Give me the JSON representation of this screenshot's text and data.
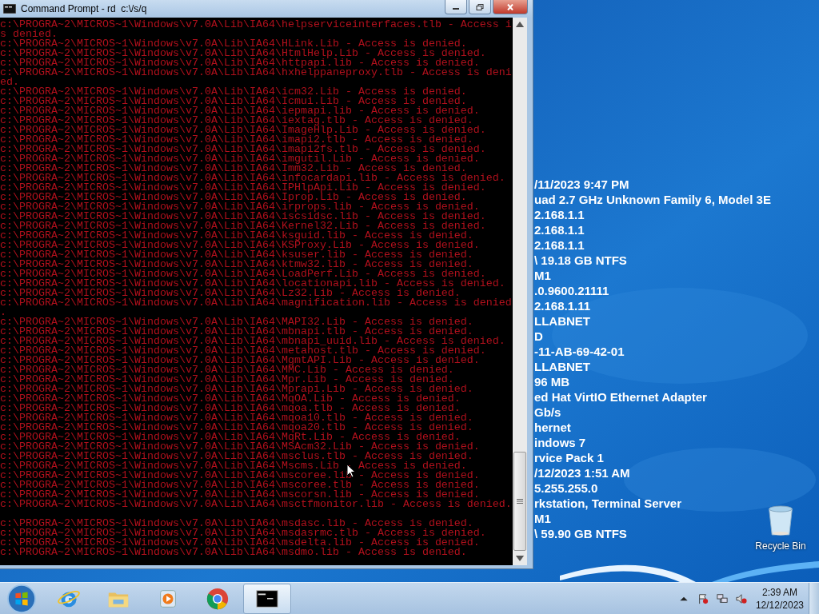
{
  "window": {
    "title": "Command Prompt - rd  c:\\/s/q",
    "console_blocks": [
      [
        "c:\\PROGRA~2\\MICROS~1\\Windows\\v7.0A\\Lib\\IA64\\helpserviceinterfaces.tlb - Access i",
        "s denied.",
        "c:\\PROGRA~2\\MICROS~1\\Windows\\v7.0A\\Lib\\IA64\\HLink.Lib - Access is denied.",
        "c:\\PROGRA~2\\MICROS~1\\Windows\\v7.0A\\Lib\\IA64\\HtmlHelp.Lib - Access is denied.",
        "c:\\PROGRA~2\\MICROS~1\\Windows\\v7.0A\\Lib\\IA64\\httpapi.lib - Access is denied.",
        "c:\\PROGRA~2\\MICROS~1\\Windows\\v7.0A\\Lib\\IA64\\hxhelppaneproxy.tlb - Access is deni",
        "ed.",
        "c:\\PROGRA~2\\MICROS~1\\Windows\\v7.0A\\Lib\\IA64\\icm32.Lib - Access is denied.",
        "c:\\PROGRA~2\\MICROS~1\\Windows\\v7.0A\\Lib\\IA64\\Icmui.Lib - Access is denied.",
        "c:\\PROGRA~2\\MICROS~1\\Windows\\v7.0A\\Lib\\IA64\\iepmapi.lib - Access is denied.",
        "c:\\PROGRA~2\\MICROS~1\\Windows\\v7.0A\\Lib\\IA64\\iextag.tlb - Access is denied.",
        "c:\\PROGRA~2\\MICROS~1\\Windows\\v7.0A\\Lib\\IA64\\ImageHlp.Lib - Access is denied.",
        "c:\\PROGRA~2\\MICROS~1\\Windows\\v7.0A\\Lib\\IA64\\imapi2.tlb - Access is denied.",
        "c:\\PROGRA~2\\MICROS~1\\Windows\\v7.0A\\Lib\\IA64\\imapi2fs.tlb - Access is denied.",
        "c:\\PROGRA~2\\MICROS~1\\Windows\\v7.0A\\Lib\\IA64\\imgutil.Lib - Access is denied.",
        "c:\\PROGRA~2\\MICROS~1\\Windows\\v7.0A\\Lib\\IA64\\Imm32.Lib - Access is denied.",
        "c:\\PROGRA~2\\MICROS~1\\Windows\\v7.0A\\Lib\\IA64\\infocardapi.lib - Access is denied.",
        "c:\\PROGRA~2\\MICROS~1\\Windows\\v7.0A\\Lib\\IA64\\IPHlpApi.Lib - Access is denied.",
        "c:\\PROGRA~2\\MICROS~1\\Windows\\v7.0A\\Lib\\IA64\\Iprop.Lib - Access is denied.",
        "c:\\PROGRA~2\\MICROS~1\\Windows\\v7.0A\\Lib\\IA64\\irprops.lib - Access is denied.",
        "c:\\PROGRA~2\\MICROS~1\\Windows\\v7.0A\\Lib\\IA64\\iscsidsc.lib - Access is denied.",
        "c:\\PROGRA~2\\MICROS~1\\Windows\\v7.0A\\Lib\\IA64\\Kernel32.Lib - Access is denied.",
        "c:\\PROGRA~2\\MICROS~1\\Windows\\v7.0A\\Lib\\IA64\\ksguid.lib - Access is denied.",
        "c:\\PROGRA~2\\MICROS~1\\Windows\\v7.0A\\Lib\\IA64\\KSProxy.Lib - Access is denied.",
        "c:\\PROGRA~2\\MICROS~1\\Windows\\v7.0A\\Lib\\IA64\\ksuser.lib - Access is denied.",
        "c:\\PROGRA~2\\MICROS~1\\Windows\\v7.0A\\Lib\\IA64\\ktmw32.lib - Access is denied.",
        "c:\\PROGRA~2\\MICROS~1\\Windows\\v7.0A\\Lib\\IA64\\LoadPerf.Lib - Access is denied.",
        "c:\\PROGRA~2\\MICROS~1\\Windows\\v7.0A\\Lib\\IA64\\locationapi.lib - Access is denied.",
        "c:\\PROGRA~2\\MICROS~1\\Windows\\v7.0A\\Lib\\IA64\\Lz32.Lib - Access is denied.",
        "c:\\PROGRA~2\\MICROS~1\\Windows\\v7.0A\\Lib\\IA64\\magnification.lib - Access is denied",
        ".",
        "c:\\PROGRA~2\\MICROS~1\\Windows\\v7.0A\\Lib\\IA64\\MAPI32.Lib - Access is denied.",
        "c:\\PROGRA~2\\MICROS~1\\Windows\\v7.0A\\Lib\\IA64\\mbnapi.tlb - Access is denied.",
        "c:\\PROGRA~2\\MICROS~1\\Windows\\v7.0A\\Lib\\IA64\\mbnapi_uuid.lib - Access is denied.",
        "c:\\PROGRA~2\\MICROS~1\\Windows\\v7.0A\\Lib\\IA64\\metahost.tlb - Access is denied.",
        "c:\\PROGRA~2\\MICROS~1\\Windows\\v7.0A\\Lib\\IA64\\MgmtAPI.Lib - Access is denied.",
        "c:\\PROGRA~2\\MICROS~1\\Windows\\v7.0A\\Lib\\IA64\\MMC.Lib - Access is denied.",
        "c:\\PROGRA~2\\MICROS~1\\Windows\\v7.0A\\Lib\\IA64\\Mpr.Lib - Access is denied.",
        "c:\\PROGRA~2\\MICROS~1\\Windows\\v7.0A\\Lib\\IA64\\Mprapi.Lib - Access is denied.",
        "c:\\PROGRA~2\\MICROS~1\\Windows\\v7.0A\\Lib\\IA64\\MqOA.Lib - Access is denied.",
        "c:\\PROGRA~2\\MICROS~1\\Windows\\v7.0A\\Lib\\IA64\\mqoa.tlb - Access is denied.",
        "c:\\PROGRA~2\\MICROS~1\\Windows\\v7.0A\\Lib\\IA64\\mqoa10.tlb - Access is denied.",
        "c:\\PROGRA~2\\MICROS~1\\Windows\\v7.0A\\Lib\\IA64\\mqoa20.tlb - Access is denied.",
        "c:\\PROGRA~2\\MICROS~1\\Windows\\v7.0A\\Lib\\IA64\\MqRt.Lib - Access is denied.",
        "c:\\PROGRA~2\\MICROS~1\\Windows\\v7.0A\\Lib\\IA64\\MSAcm32.Lib - Access is denied.",
        "c:\\PROGRA~2\\MICROS~1\\Windows\\v7.0A\\Lib\\IA64\\msclus.tlb - Access is denied.",
        "c:\\PROGRA~2\\MICROS~1\\Windows\\v7.0A\\Lib\\IA64\\Mscms.Lib - Access is denied.",
        "c:\\PROGRA~2\\MICROS~1\\Windows\\v7.0A\\Lib\\IA64\\mscoree.lib - Access is denied.",
        "c:\\PROGRA~2\\MICROS~1\\Windows\\v7.0A\\Lib\\IA64\\mscoree.tlb - Access is denied.",
        "c:\\PROGRA~2\\MICROS~1\\Windows\\v7.0A\\Lib\\IA64\\mscorsn.lib - Access is denied.",
        "c:\\PROGRA~2\\MICROS~1\\Windows\\v7.0A\\Lib\\IA64\\msctfmonitor.lib - Access is denied."
      ],
      [
        "c:\\PROGRA~2\\MICROS~1\\Windows\\v7.0A\\Lib\\IA64\\msdasc.lib - Access is denied.",
        "c:\\PROGRA~2\\MICROS~1\\Windows\\v7.0A\\Lib\\IA64\\msdasrmc.tlb - Access is denied.",
        "c:\\PROGRA~2\\MICROS~1\\Windows\\v7.0A\\Lib\\IA64\\msdelta.lib - Access is denied.",
        "c:\\PROGRA~2\\MICROS~1\\Windows\\v7.0A\\Lib\\IA64\\msdmo.lib - Access is denied."
      ]
    ]
  },
  "desktop": {
    "info_lines": [
      "/11/2023 9:47 PM",
      "uad 2.7 GHz Unknown Family 6, Model 3E",
      "2.168.1.1",
      "2.168.1.1",
      "2.168.1.1",
      "\\ 19.18 GB NTFS",
      "M1",
      ".0.9600.21111",
      "2.168.1.11",
      "LLABNET",
      "D",
      "-11-AB-69-42-01",
      "LLABNET",
      "96 MB",
      "ed Hat VirtIO Ethernet Adapter",
      "Gb/s",
      "hernet",
      "indows 7",
      "rvice Pack 1",
      "/12/2023 1:51 AM",
      "5.255.255.0",
      "rkstation, Terminal Server",
      "M1",
      "\\ 59.90 GB NTFS"
    ],
    "icons": [
      {
        "label": "Recycle Bin"
      }
    ]
  },
  "taskbar": {
    "apps": [
      {
        "kind": "browser",
        "selected": false
      },
      {
        "kind": "folder",
        "selected": false
      },
      {
        "kind": "media",
        "selected": false
      },
      {
        "kind": "chrome",
        "selected": false
      },
      {
        "kind": "terminal",
        "selected": true
      }
    ],
    "clock": {
      "time": "2:39 AM",
      "date": "12/12/2023"
    }
  }
}
